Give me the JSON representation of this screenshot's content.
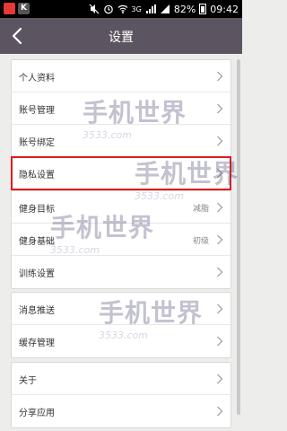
{
  "status_bar": {
    "app_badges": [
      "K"
    ],
    "battery": "82%",
    "time": "09:42",
    "network": "3G"
  },
  "header": {
    "title": "设置"
  },
  "groups": [
    {
      "items": [
        {
          "label": "个人资料"
        },
        {
          "label": "账号管理"
        },
        {
          "label": "账号绑定"
        },
        {
          "label": "隐私设置"
        }
      ]
    },
    {
      "items": [
        {
          "label": "健身目标",
          "value": "减脂"
        },
        {
          "label": "健身基础",
          "value": "初级"
        },
        {
          "label": "训练设置"
        }
      ]
    },
    {
      "items": [
        {
          "label": "消息推送"
        },
        {
          "label": "缓存管理"
        }
      ]
    },
    {
      "items": [
        {
          "label": "关于"
        },
        {
          "label": "分享应用"
        }
      ]
    }
  ],
  "watermark": {
    "brand": "手机世界",
    "site": "3533.com"
  }
}
